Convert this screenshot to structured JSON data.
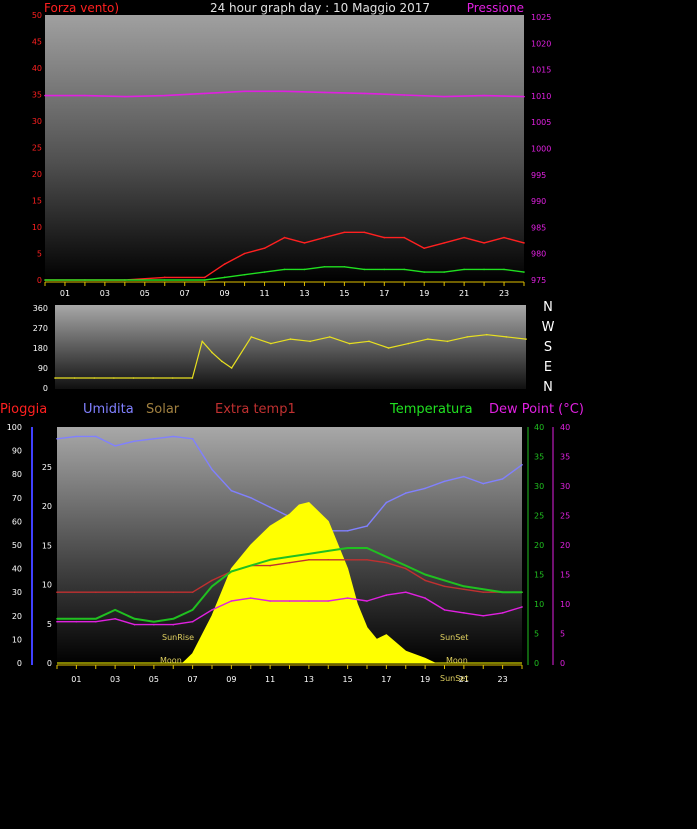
{
  "title": "24 hour graph day : 10 Maggio 2017",
  "colors": {
    "wind": "#ff2020",
    "gust_avg": "#20e020",
    "pressure": "#e020e0",
    "direction": "#e8e020",
    "humidity": "#8080ff",
    "solar": "#ffff00",
    "solar_label": "#a08040",
    "extra_temp": "#c03030",
    "temperature": "#20c020",
    "dewpoint": "#e020e0",
    "rain": "#ff2020",
    "rain_axis": "#4040ff",
    "hour_tick": "#e0c000"
  },
  "chart_data": [
    {
      "type": "line",
      "panel": "wind-pressure",
      "left_label": "Forza vento)",
      "right_label": "Pressione",
      "x_ticks": [
        "01",
        "03",
        "05",
        "07",
        "09",
        "11",
        "13",
        "15",
        "17",
        "19",
        "21",
        "23"
      ],
      "y_left_ticks": [
        "50",
        "45",
        "40",
        "35",
        "30",
        "25",
        "20",
        "15",
        "10",
        "5",
        "0"
      ],
      "y_right_ticks": [
        "1025",
        "1020",
        "1015",
        "1010",
        "1005",
        "1000",
        "995",
        "990",
        "985",
        "980",
        "975"
      ],
      "ylim_left": [
        0,
        50
      ],
      "ylim_right": [
        975,
        1025
      ],
      "series": [
        {
          "key": "pressure",
          "axis": "right",
          "x": [
            0,
            2,
            4,
            6,
            8,
            10,
            12,
            14,
            16,
            18,
            20,
            22,
            24
          ],
          "values": [
            1009.8,
            1009.8,
            1009.6,
            1009.8,
            1010.2,
            1010.6,
            1010.6,
            1010.4,
            1010.2,
            1009.9,
            1009.6,
            1009.8,
            1009.6
          ]
        },
        {
          "key": "wind",
          "axis": "left",
          "x": [
            0,
            2,
            4,
            6,
            8,
            9,
            10,
            11,
            12,
            13,
            14,
            15,
            16,
            17,
            18,
            19,
            20,
            21,
            22,
            23,
            24
          ],
          "values": [
            0,
            0,
            0,
            0.5,
            0.5,
            3,
            5,
            6,
            8,
            7,
            8,
            9,
            9,
            8,
            8,
            6,
            7,
            8,
            7,
            8,
            7
          ]
        },
        {
          "key": "gust_avg",
          "axis": "left",
          "x": [
            0,
            2,
            4,
            6,
            8,
            9,
            10,
            11,
            12,
            13,
            14,
            15,
            16,
            17,
            18,
            19,
            20,
            21,
            22,
            23,
            24
          ],
          "values": [
            0,
            0,
            0,
            0,
            0,
            0.5,
            1,
            1.5,
            2,
            2,
            2.5,
            2.5,
            2,
            2,
            2,
            1.5,
            1.5,
            2,
            2,
            2,
            1.5
          ]
        }
      ]
    },
    {
      "type": "line",
      "panel": "wind-direction",
      "y_ticks": [
        "360",
        "270",
        "180",
        "90",
        "0"
      ],
      "compass": [
        "N",
        "W",
        "S",
        "E",
        "N"
      ],
      "ylim": [
        0,
        360
      ],
      "series": [
        {
          "key": "direction",
          "x": [
            0,
            1,
            2,
            3,
            4,
            5,
            6,
            7,
            7.5,
            8,
            8.5,
            9,
            10,
            11,
            12,
            13,
            14,
            15,
            16,
            17,
            18,
            19,
            20,
            21,
            22,
            23,
            24
          ],
          "values": [
            45,
            45,
            45,
            45,
            45,
            45,
            45,
            45,
            210,
            160,
            120,
            90,
            230,
            200,
            220,
            210,
            230,
            200,
            210,
            180,
            200,
            220,
            210,
            230,
            240,
            230,
            220
          ]
        }
      ]
    },
    {
      "type": "line",
      "panel": "temperature-humidity-solar",
      "legend": [
        "Pioggia",
        "Umidita",
        "Solar",
        "Extra temp1",
        "Temperatura",
        "Dew Point (°C)"
      ],
      "x_ticks": [
        "01",
        "03",
        "05",
        "07",
        "09",
        "11",
        "13",
        "15",
        "17",
        "19",
        "21",
        "23"
      ],
      "y_humidity_ticks": [
        "100",
        "90",
        "80",
        "70",
        "60",
        "50",
        "40",
        "30",
        "20",
        "10",
        "0"
      ],
      "y_rain_ticks": [
        "25",
        "20",
        "15",
        "10",
        "5",
        "0"
      ],
      "y_temp_ticks": [
        "40",
        "35",
        "30",
        "25",
        "20",
        "15",
        "10",
        "5",
        "0"
      ],
      "y_dew_ticks": [
        "40",
        "35",
        "30",
        "25",
        "20",
        "15",
        "10",
        "5",
        "0"
      ],
      "ylim_humidity": [
        0,
        100
      ],
      "ylim_temp": [
        0,
        40
      ],
      "annotations": [
        "SunRise",
        "Moon",
        "SunSet",
        "SunSet",
        "Moon"
      ],
      "series": [
        {
          "key": "humidity",
          "axis": "humidity",
          "x": [
            0,
            1,
            2,
            3,
            4,
            5,
            6,
            7,
            8,
            9,
            10,
            11,
            12,
            13,
            14,
            15,
            16,
            17,
            18,
            19,
            20,
            21,
            22,
            23,
            24
          ],
          "values": [
            95,
            96,
            96,
            92,
            94,
            95,
            96,
            95,
            82,
            73,
            70,
            66,
            62,
            60,
            56,
            56,
            58,
            68,
            72,
            74,
            77,
            79,
            76,
            78,
            84
          ]
        },
        {
          "key": "solar",
          "axis": "humidity",
          "x": [
            0,
            6.5,
            7,
            8,
            9,
            10,
            11,
            12,
            12.5,
            13,
            14,
            15,
            15.5,
            16,
            16.5,
            17,
            18,
            19,
            19.5,
            24
          ],
          "values": [
            0,
            0,
            4,
            20,
            40,
            50,
            58,
            63,
            67,
            68,
            60,
            40,
            25,
            15,
            10,
            12,
            5,
            2,
            0,
            0
          ]
        },
        {
          "key": "extra_temp",
          "axis": "temp",
          "x": [
            0,
            2,
            4,
            6,
            7,
            8,
            9,
            10,
            11,
            12,
            13,
            14,
            15,
            16,
            17,
            18,
            19,
            20,
            21,
            22,
            23,
            24
          ],
          "values": [
            12,
            12,
            12,
            12,
            12,
            14,
            15.5,
            16.5,
            16.5,
            17,
            17.5,
            17.5,
            17.5,
            17.5,
            17,
            16,
            14,
            13,
            12.5,
            12,
            12,
            12
          ]
        },
        {
          "key": "temperature",
          "axis": "temp",
          "x": [
            0,
            1,
            2,
            3,
            4,
            5,
            6,
            7,
            8,
            9,
            10,
            11,
            12,
            13,
            14,
            15,
            16,
            17,
            18,
            19,
            20,
            21,
            22,
            23,
            24
          ],
          "values": [
            7.5,
            7.5,
            7.5,
            9,
            7.5,
            7,
            7.5,
            9,
            13,
            15.5,
            16.5,
            17.5,
            18,
            18.5,
            19,
            19.5,
            19.5,
            18,
            16.5,
            15,
            14,
            13,
            12.5,
            12,
            12
          ]
        },
        {
          "key": "dewpoint",
          "axis": "temp",
          "x": [
            0,
            1,
            2,
            3,
            4,
            5,
            6,
            7,
            8,
            9,
            10,
            11,
            12,
            13,
            14,
            15,
            16,
            17,
            18,
            19,
            20,
            21,
            22,
            23,
            24
          ],
          "values": [
            7,
            7,
            7,
            7.5,
            6.5,
            6.5,
            6.5,
            7,
            9,
            10.5,
            11,
            10.5,
            10.5,
            10.5,
            10.5,
            11,
            10.5,
            11.5,
            12,
            11,
            9,
            8.5,
            8,
            8.5,
            9.5
          ]
        }
      ]
    }
  ]
}
